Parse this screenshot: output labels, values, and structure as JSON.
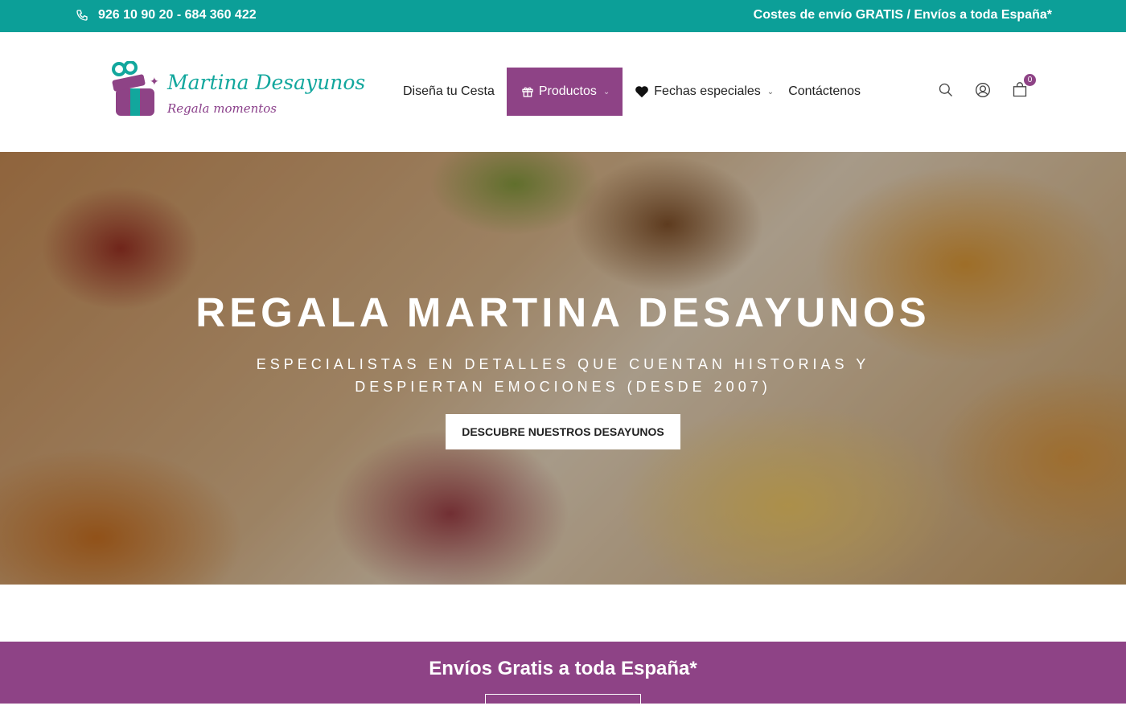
{
  "topbar": {
    "phone_icon": "phone-icon",
    "phone": "926 10 90 20 - 684 360 422",
    "promo": "Costes de envío GRATIS / Envíos a toda España*"
  },
  "logo": {
    "brand": "Martina Desayunos",
    "tagline": "Regala momentos"
  },
  "nav": {
    "items": [
      {
        "label": "Diseña tu Cesta"
      },
      {
        "label": "Productos",
        "icon": "gift-icon",
        "active": true
      },
      {
        "label": "Fechas especiales",
        "icon": "heart-icon"
      },
      {
        "label": "Contáctenos"
      }
    ]
  },
  "tools": {
    "search_icon": "search-icon",
    "account_icon": "user-icon",
    "cart_icon": "cart-icon",
    "cart_count": "0"
  },
  "hero": {
    "title": "REGALA MARTINA DESAYUNOS",
    "subtitle": "ESPECIALISTAS EN DETALLES QUE CUENTAN HISTORIAS Y DESPIERTAN EMOCIONES (DESDE 2007)",
    "cta": "DESCUBRE NUESTROS DESAYUNOS"
  },
  "band": {
    "title": "Envíos Gratis a toda España*"
  },
  "colors": {
    "teal": "#0c9f98",
    "purple": "#8e4386"
  }
}
